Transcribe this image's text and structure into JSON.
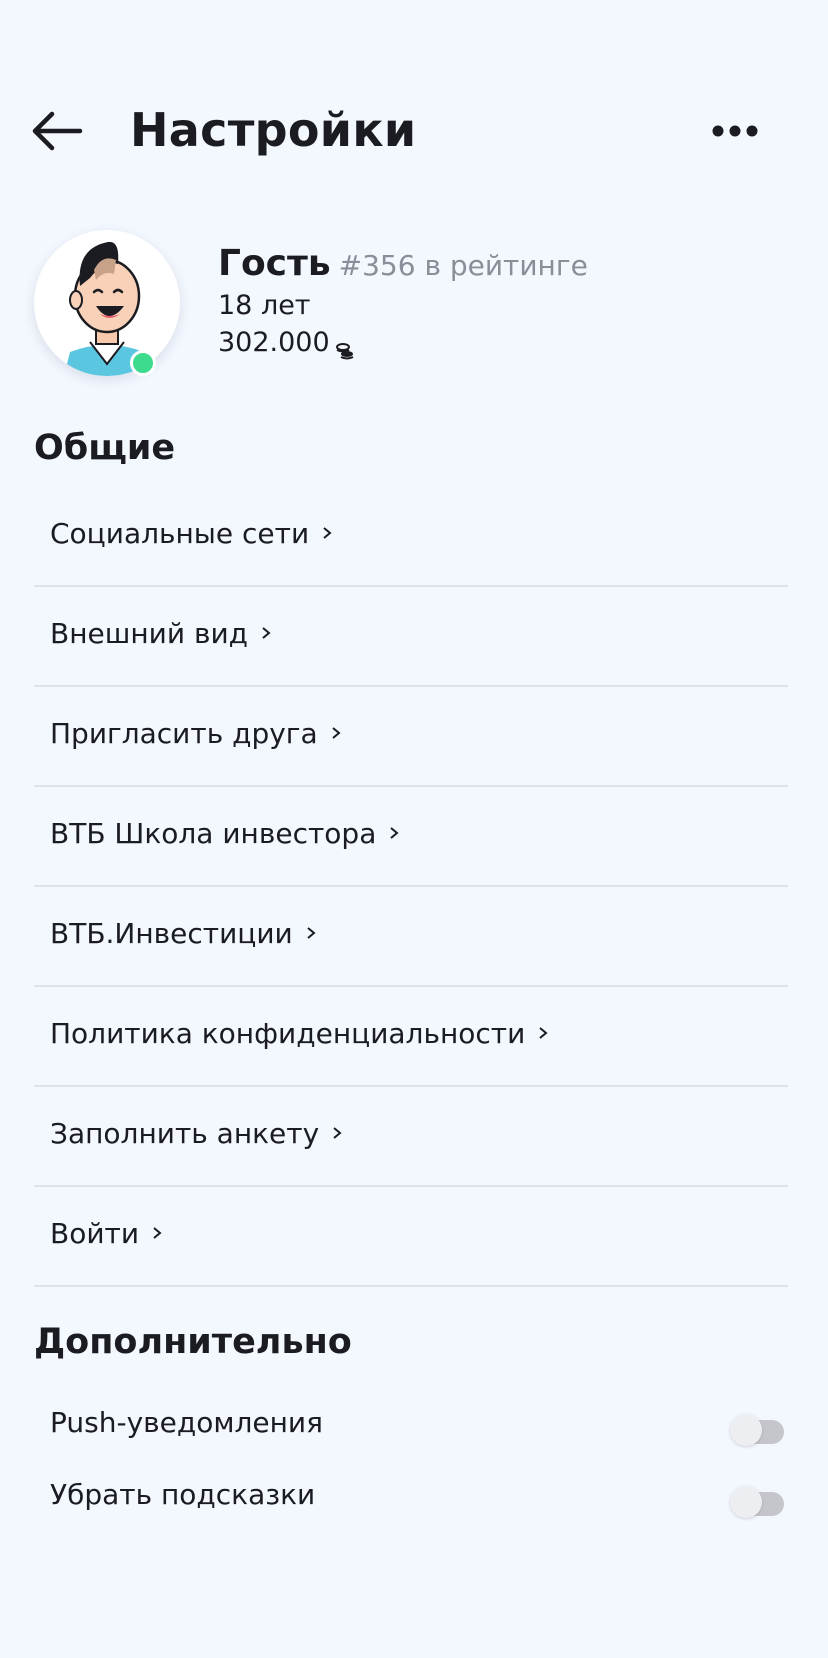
{
  "header": {
    "title": "Настройки",
    "back_icon": "arrow-left-icon",
    "more_icon": "more-horizontal-icon"
  },
  "profile": {
    "name": "Гость",
    "rank": "#356 в рейтинге",
    "age": "18 лет",
    "balance": "302.000",
    "balance_icon": "coins-icon",
    "online": true,
    "online_color": "#3ddb8e"
  },
  "sections": {
    "general_title": "Общие",
    "general_items": [
      {
        "label": "Социальные сети"
      },
      {
        "label": "Внешний вид"
      },
      {
        "label": "Пригласить друга"
      },
      {
        "label": "ВТБ Школа инвестора"
      },
      {
        "label": "ВТБ.Инвестиции"
      },
      {
        "label": "Политика конфиденциальности"
      },
      {
        "label": "Заполнить анкету"
      },
      {
        "label": "Войти"
      }
    ],
    "extra_title": "Дополнительно",
    "toggles": [
      {
        "label": "Push-уведомления",
        "enabled": false
      },
      {
        "label": "Убрать подсказки",
        "enabled": false
      }
    ]
  },
  "colors": {
    "background": "#f3f7fe",
    "text": "#1b1c21",
    "muted": "#8a8e98",
    "divider": "#dfe3eb"
  }
}
